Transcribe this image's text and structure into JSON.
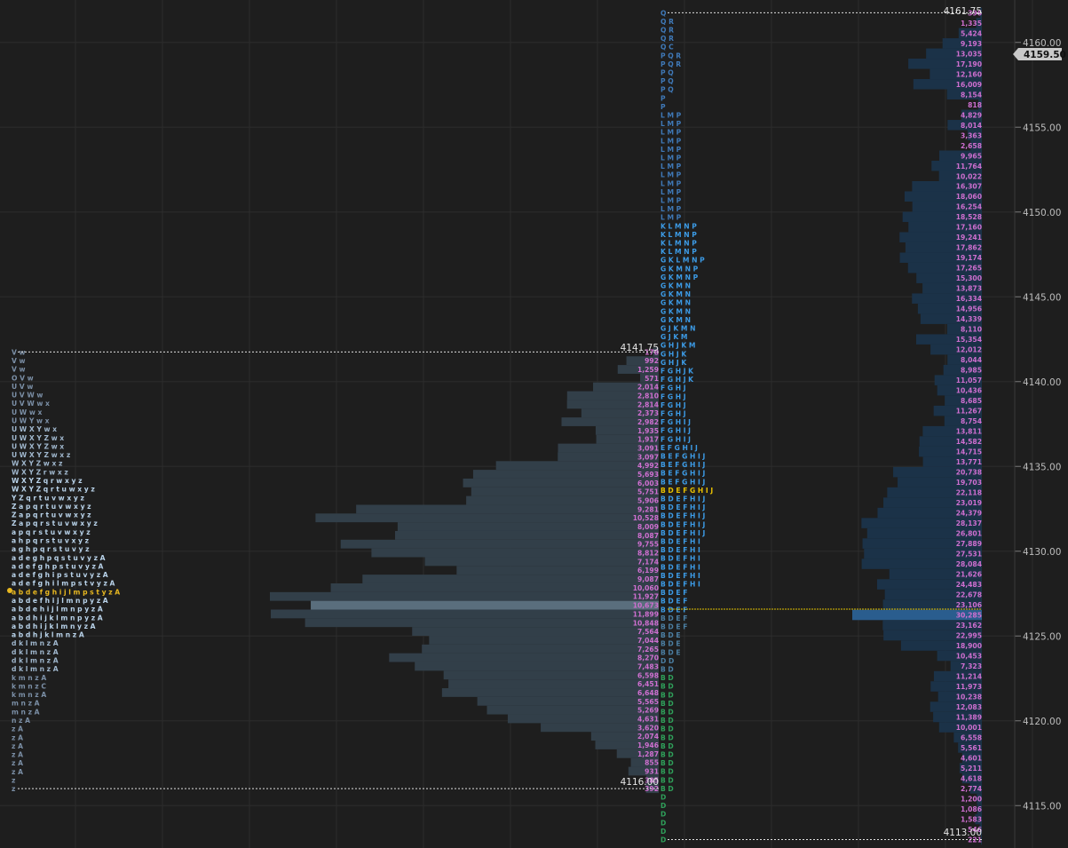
{
  "colors": {
    "background": "#1e1e1e",
    "grid": "#2c2c2c",
    "tpo_profile": "#323f49",
    "tpo_poc": "#5a6e7d",
    "vol_profile": "#1b3248",
    "vol_poc": "#2a5d8e",
    "vol_number": "#cf6fd0",
    "poc_line": "#e0c000",
    "current_price_bg": "#c9c9c9",
    "current_price_text": "#111111"
  },
  "chart_data": {
    "type": "market-profile",
    "price_step": 0.25,
    "y_axis": {
      "min": 4112.5,
      "max": 4162.5,
      "ticks": [
        4115.0,
        4120.0,
        4125.0,
        4130.0,
        4135.0,
        4140.0,
        4145.0,
        4150.0,
        4155.0,
        4160.0
      ],
      "tick_labels": [
        "4115.00",
        "4120.00",
        "4125.00",
        "4130.00",
        "4135.00",
        "4140.00",
        "4145.00",
        "4150.00",
        "4155.00",
        "4160.00"
      ]
    },
    "current_price": "4159.50",
    "left_profile": {
      "high_label": "4141.75",
      "low_label": "4116.00",
      "tpo_rows": [
        {
          "price": 4141.75,
          "letters": "V w",
          "count": 2
        },
        {
          "price": 4141.5,
          "letters": "V w",
          "count": 2
        },
        {
          "price": 4141.25,
          "letters": "V w",
          "count": 2
        },
        {
          "price": 4141.0,
          "letters": "O V w",
          "count": 3
        },
        {
          "price": 4140.75,
          "letters": "U V w",
          "count": 3
        },
        {
          "price": 4140.5,
          "letters": "U V W w",
          "count": 4
        },
        {
          "price": 4140.25,
          "letters": "U V W w x",
          "count": 5
        },
        {
          "price": 4140.0,
          "letters": "U W w x",
          "count": 4
        },
        {
          "price": 4139.75,
          "letters": "U W Y w x",
          "count": 5
        },
        {
          "price": 4139.5,
          "letters": "U W X Y w x",
          "count": 6
        },
        {
          "price": 4139.25,
          "letters": "U W X Y Z w x",
          "count": 7
        },
        {
          "price": 4139.0,
          "letters": "U W X Y Z w x",
          "count": 7
        },
        {
          "price": 4138.75,
          "letters": "U W X Y Z w x z",
          "count": 8
        },
        {
          "price": 4138.5,
          "letters": "W X Y Z w x z",
          "count": 7
        },
        {
          "price": 4138.25,
          "letters": "W X Y Z r w x z",
          "count": 8
        },
        {
          "price": 4138.0,
          "letters": "W X Y Z q r w x y z",
          "count": 10
        },
        {
          "price": 4137.75,
          "letters": "W X Y Z q r t u w x y z",
          "count": 12
        },
        {
          "price": 4137.5,
          "letters": "Y Z q r t u v w x y z",
          "count": 11
        },
        {
          "price": 4137.25,
          "letters": "Z a p q r t u v w x y z",
          "count": 12
        },
        {
          "price": 4137.0,
          "letters": "Z a p q r t u v w x y z",
          "count": 12
        },
        {
          "price": 4136.75,
          "letters": "Z a p q r s t u v w x y z",
          "count": 13
        },
        {
          "price": 4136.5,
          "letters": "a p q r s t u v w x y z",
          "count": 12
        },
        {
          "price": 4136.25,
          "letters": "a h p q r s t u v x y z",
          "count": 12
        },
        {
          "price": 4136.0,
          "letters": "a g h p q r s t u v y z",
          "count": 12
        },
        {
          "price": 4135.75,
          "letters": "a d e g h p q s t u v y z A",
          "count": 14
        },
        {
          "price": 4135.5,
          "letters": "a d e f g h p s t u v y z A",
          "count": 14
        },
        {
          "price": 4135.25,
          "letters": "a d e f g h i p s t u v y z A",
          "count": 15
        },
        {
          "price": 4135.0,
          "letters": "a d e f g h i l m p s t v y z A",
          "count": 16
        },
        {
          "price": 4134.75,
          "letters": "a b d e f g h i j l m p s t y z A",
          "count": 17,
          "poc": true
        },
        {
          "price": 4134.5,
          "letters": "a b d e f h i j l m n p y z A",
          "count": 15
        },
        {
          "price": 4134.25,
          "letters": "a b d e h i j l m n p y z A",
          "count": 14
        },
        {
          "price": 4134.0,
          "letters": "a b d h i j k l m n p y z A",
          "count": 14
        },
        {
          "price": 4133.75,
          "letters": "a b d h i j k l m n y z A",
          "count": 13
        },
        {
          "price": 4133.5,
          "letters": "a b d h j k l m n z A",
          "count": 11
        },
        {
          "price": 4133.25,
          "letters": "d k l m n z A",
          "count": 7
        },
        {
          "price": 4133.0,
          "letters": "d k l m n z A",
          "count": 7
        },
        {
          "price": 4132.75,
          "letters": "d k l m n z A",
          "count": 7
        },
        {
          "price": 4132.5,
          "letters": "d k l m n z A",
          "count": 7
        },
        {
          "price": 4132.25,
          "letters": "k m n z A",
          "count": 5
        },
        {
          "price": 4132.0,
          "letters": "k m n z C",
          "count": 5
        },
        {
          "price": 4131.75,
          "letters": "k m n z A",
          "count": 5
        },
        {
          "price": 4131.5,
          "letters": "m n z A",
          "count": 4
        },
        {
          "price": 4131.25,
          "letters": "m n z A",
          "count": 4
        },
        {
          "price": 4131.0,
          "letters": "n z A",
          "count": 3
        },
        {
          "price": 4130.75,
          "letters": "z A",
          "count": 2
        },
        {
          "price": 4130.5,
          "letters": "z A",
          "count": 2
        },
        {
          "price": 4130.25,
          "letters": "z A",
          "count": 2
        },
        {
          "price": 4130.0,
          "letters": "z A",
          "count": 2
        },
        {
          "price": 4129.75,
          "letters": "z A",
          "count": 2
        },
        {
          "price": 4129.5,
          "letters": "z A",
          "count": 2
        },
        {
          "price": 4129.25,
          "letters": "z",
          "count": 1
        },
        {
          "price": 4129.0,
          "letters": "z",
          "count": 1
        }
      ]
    },
    "middle_profile": {
      "high_label": "4161.75",
      "low_label": "4113.00",
      "volumes": [
        "396",
        "1,335",
        "5,424",
        "9,193",
        "13,035",
        "17,190",
        "12,160",
        "16,009",
        "8,154",
        "818",
        "4,829",
        "8,014",
        "3,363",
        "2,658",
        "9,965",
        "11,764",
        "10,022",
        "16,307",
        "18,060",
        "16,254",
        "18,528",
        "17,160",
        "19,241",
        "17,862",
        "19,174",
        "17,265",
        "15,300",
        "13,873",
        "16,334",
        "14,956",
        "14,339",
        "8,110",
        "15,354",
        "12,012",
        "8,044",
        "8,985",
        "11,057",
        "10,436",
        "8,685",
        "11,267",
        "8,754",
        "13,811",
        "14,582",
        "14,715",
        "13,771",
        "20,738",
        "19,703",
        "22,118",
        "23,019",
        "24,379",
        "28,137",
        "26,801",
        "27,889",
        "27,531",
        "28,084",
        "21,626",
        "24,483",
        "22,678",
        "23,106",
        "30,285",
        "23,162",
        "22,995",
        "18,900",
        "10,453",
        "7,323",
        "11,214",
        "11,973",
        "10,238",
        "12,083",
        "11,389",
        "10,001",
        "6,558",
        "5,561",
        "4,601",
        "5,211",
        "4,618",
        "2,774",
        "1,200",
        "1,086",
        "1,583",
        "546",
        "221"
      ]
    },
    "right_column": {
      "volumes": [
        "178",
        "992",
        "1,259",
        "571",
        "2,014",
        "2,810",
        "2,814",
        "2,373",
        "2,982",
        "1,935",
        "1,917",
        "3,091",
        "3,097",
        "4,992",
        "5,693",
        "6,003",
        "5,751",
        "5,906",
        "9,281",
        "10,528",
        "8,009",
        "8,087",
        "9,755",
        "8,812",
        "7,174",
        "6,199",
        "9,087",
        "10,060",
        "11,927",
        "10,673",
        "11,899",
        "10,848",
        "7,564",
        "7,044",
        "7,265",
        "8,270",
        "7,483",
        "6,598",
        "6,451",
        "6,648",
        "5,565",
        "5,269",
        "4,631",
        "3,620",
        "2,074",
        "1,946",
        "1,287",
        "855",
        "931",
        "385",
        "392"
      ]
    }
  }
}
